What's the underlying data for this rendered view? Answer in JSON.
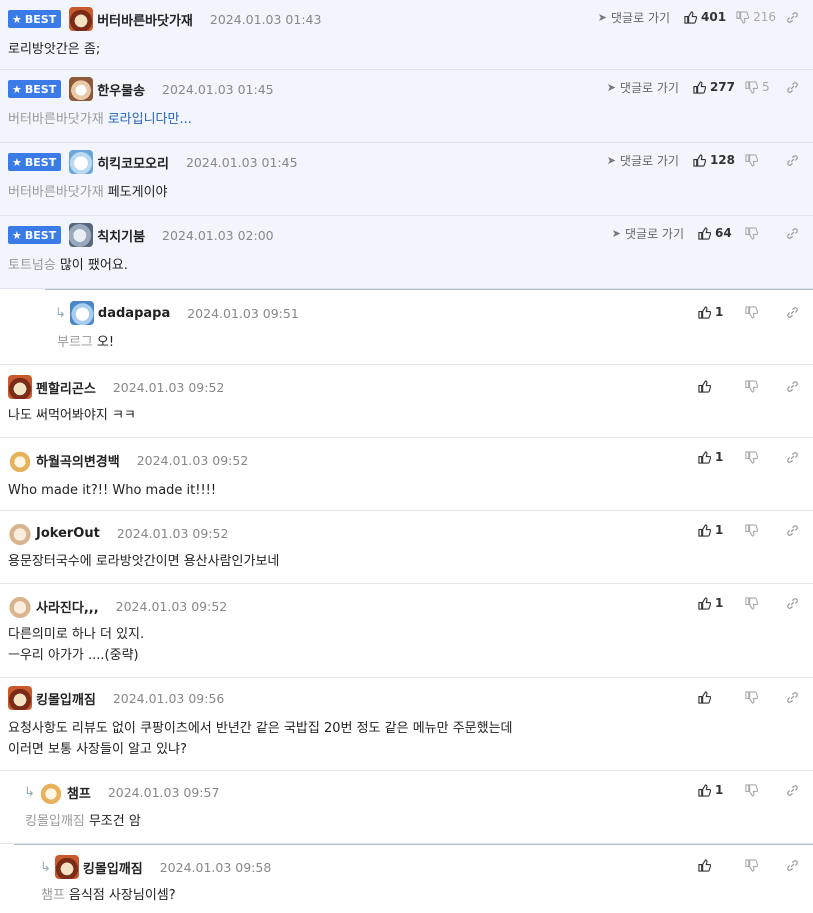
{
  "ui": {
    "best_label": "BEST",
    "goto_reply_label": "댓글로 가기"
  },
  "colors": {
    "best_bg": "#f2f5fb",
    "badge": "#3b7be8",
    "link_blue": "#2a63b8"
  },
  "comments": [
    {
      "best": true,
      "nick": "버터바른바닷가재",
      "date": "2024.01.03 01:43",
      "target": "",
      "text": "로리방앗간은 좀;",
      "likes": "401",
      "dislikes": "216",
      "avatar": "dog1"
    },
    {
      "best": true,
      "nick": "한우물송",
      "date": "2024.01.03 01:45",
      "target": "버터바른바닷가재",
      "text": "로라입니다만...",
      "likes": "277",
      "dislikes": "5",
      "avatar": "dog2"
    },
    {
      "best": true,
      "nick": "히킥코모오리",
      "date": "2024.01.03 01:45",
      "target": "버터바른바닷가재",
      "text": "페도게이야",
      "likes": "128",
      "dislikes": "",
      "avatar": "ice"
    },
    {
      "best": true,
      "nick": "칙치기붐",
      "date": "2024.01.03 02:00",
      "target": "토트넘승",
      "text": "많이 팼어요.",
      "likes": "64",
      "dislikes": "",
      "avatar": "mix"
    },
    {
      "best": false,
      "nick": "dadapapa",
      "date": "2024.01.03 09:51",
      "target": "부르그",
      "text": "오!",
      "likes": "1",
      "dislikes": "",
      "avatar": "dada"
    },
    {
      "best": false,
      "nick": "펜할리곤스",
      "date": "2024.01.03 09:52",
      "target": "",
      "text": "나도 써먹어봐야지 ㅋㅋ",
      "likes": "",
      "dislikes": "",
      "avatar": "dog1"
    },
    {
      "best": false,
      "nick": "하월곡의변경백",
      "date": "2024.01.03 09:52",
      "target": "",
      "text": "Who made it?!! Who made it!!!!",
      "likes": "1",
      "dislikes": "",
      "avatar": "fox"
    },
    {
      "best": false,
      "nick": "JokerOut",
      "date": "2024.01.03 09:52",
      "target": "",
      "text": "용문장터국수에 로라방앗간이면 용산사람인가보네",
      "likes": "1",
      "dislikes": "",
      "avatar": "puppy"
    },
    {
      "best": false,
      "nick": "사라진다,,,",
      "date": "2024.01.03 09:52",
      "target": "",
      "text": "다른의미로 하나 더 있지.",
      "text2": "ㅡ우리 아가가 ....(중략)",
      "likes": "1",
      "dislikes": "",
      "avatar": "puppy"
    },
    {
      "best": false,
      "nick": "킹몰입깨짐",
      "date": "2024.01.03 09:56",
      "target": "",
      "text": "요청사항도 리뷰도 없이 쿠팡이츠에서 반년간 같은 국밥집 20번 정도 같은 메뉴만 주문했는데",
      "text2": "이러면 보통 사장들이 알고 있냐?",
      "likes": "",
      "dislikes": "",
      "avatar": "dog1"
    },
    {
      "best": false,
      "nick": "챔프",
      "date": "2024.01.03 09:57",
      "target": "킹몰입깨짐",
      "text": "무조건 암",
      "likes": "1",
      "dislikes": "",
      "avatar": "fox"
    },
    {
      "best": false,
      "nick": "킹몰입깨짐",
      "date": "2024.01.03 09:58",
      "target": "챔프",
      "text": "음식점 사장님이셈?",
      "likes": "",
      "dislikes": "",
      "avatar": "dog1"
    }
  ]
}
